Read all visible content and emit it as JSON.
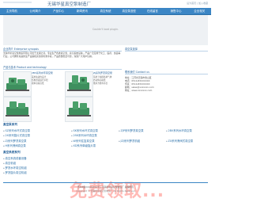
{
  "header": {
    "title": "无锡华星真空泵制造厂",
    "top_links": "设为首页 | 加入收藏"
  },
  "nav": [
    "主页导航",
    "公司简介",
    "产品中心",
    "新闻资讯",
    "真空系统",
    "真空泵选型",
    "在线留言",
    "销售中心",
    "企业相关"
  ],
  "flash": {
    "text": "Couldn't load plugin."
  },
  "intro": {
    "title": "企业简介 Enterprise synopsis",
    "text": "无锡华星真空泵制造有限公司位于太湖之滨，专业生产各类真空泵、真空系统设备，产品广泛应用于化工、医药、食品等行业。公司拥有先进的生产设备和完善的检测手段，产品质量稳定可靠，深受广大用户信赖。"
  },
  "products": {
    "title": "产品与技术 Product and technology",
    "items": [
      {
        "name": "2BV系列水环真空泵",
        "lines": [
          "采用先进的设计",
          "结构紧凑运行平稳",
          "效率高噪音低"
        ]
      },
      {
        "name": "ZJ系列罗茨真空泵",
        "lines": [
          "适用于抽除各种气体",
          "启动快功耗低",
          "维护方便寿命长"
        ]
      }
    ]
  },
  "news": {
    "title": "真空泵选择"
  },
  "contact": {
    "title": "联系我们 Contact us",
    "lines": [
      "地址：江苏省无锡市惠山区",
      "电话：0510-83XXXXXX",
      "传真：0510-83XXXXXX",
      "邮箱：sales@xxxxxxx.com",
      "网址：www.xxxxxxx.com"
    ]
  },
  "catalog": {
    "categories": [
      {
        "name": "真空泵系列",
        "items": [
          "SZ系列水环式真空泵",
          "SK系列水环式真空泵",
          "ZJP系列罗茨真空泵",
          "2BV系列水环真空泵",
          "2X系列旋片式真空泵",
          "2SK系列水环真空泵"
        ]
      },
      {
        "name": "真空泵系列",
        "items": [
          "ZJ系列罗茨真空泵",
          "W系列往复真空泵",
          "JZJ系列罗茨机组",
          "ZX系列滑阀式真空泵",
          "H系列滑阀真空泵",
          "XD系列单级旋片泵"
        ]
      },
      {
        "name": "真空系统系列",
        "items": [
          "真空系统成套设备",
          "真空机组",
          "罗茨水环真空机组",
          "罗茨旋片真空机组"
        ]
      }
    ]
  },
  "footer": {
    "line1": "苏ICP备XXXXXXXX号 | 无锡华星真空泵制造厂 版权所有",
    "line2": "Copyright © 无锡华星真空泵制造厂 All Rights Reserved"
  },
  "watermark": "免费领取..."
}
